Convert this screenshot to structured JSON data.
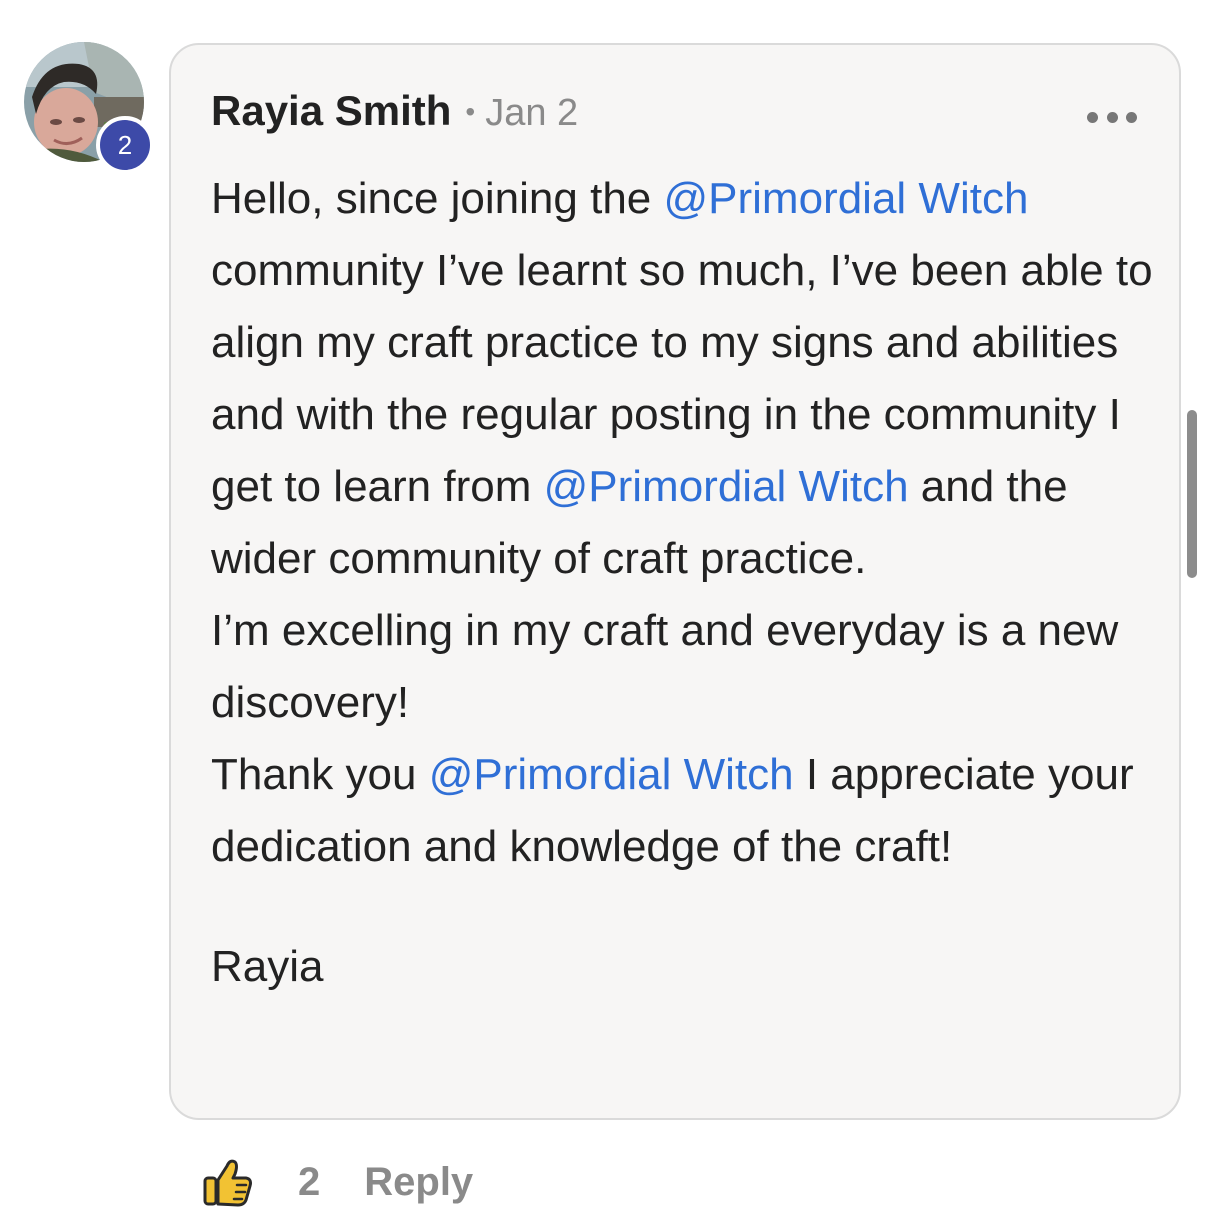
{
  "comment": {
    "author": {
      "name": "Rayia Smith",
      "avatar_icon": "user-photo",
      "level_badge": "2"
    },
    "separator": "•",
    "date": "Jan 2",
    "more_icon": "ellipsis-horizontal-icon",
    "body": {
      "p1": {
        "t1": "Hello, since joining the ",
        "m1": "@Primordial Witch",
        "t2": " community I’ve learnt so much, I’ve been able to align my craft practice to my signs and abilities and with the regular posting in the community I get to learn from ",
        "m2": "@Primordial Witch",
        "t3": " and the wider community of craft practice."
      },
      "p2": "I’m excelling in my craft and everyday is a new discovery!",
      "p3": {
        "t1": "Thank you ",
        "m1": "@Primordial Witch",
        "t2": " I appreciate your dedication and knowledge of the craft!"
      },
      "signature": "Rayia"
    },
    "actions": {
      "like_icon": "thumbs-up-icon",
      "like_count": "2",
      "reply_label": "Reply"
    }
  },
  "colors": {
    "mention": "#2f6fd6",
    "badge": "#3d4aa8",
    "card_background": "#f7f6f5",
    "muted_text": "#8a8a8a"
  }
}
